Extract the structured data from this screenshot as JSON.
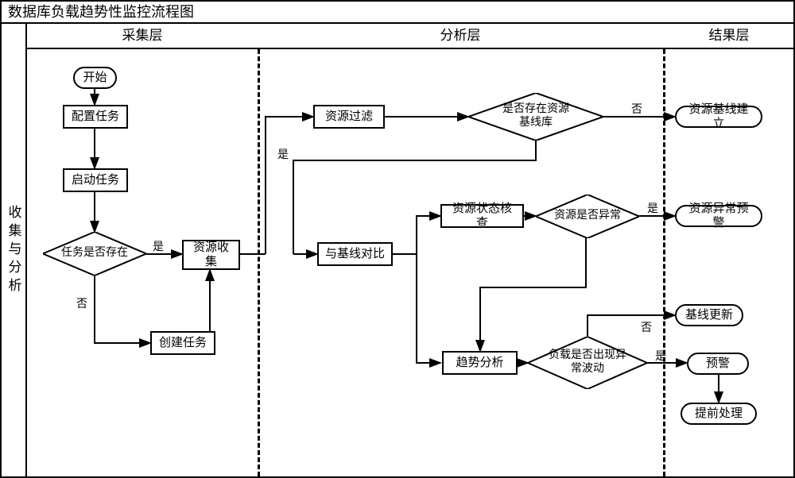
{
  "title": "数据库负载趋势性监控流程图",
  "headers": {
    "col1": "采集层",
    "col2": "分析层",
    "col3": "结果层"
  },
  "side_label": "收集与分析",
  "nodes": {
    "start": "开始",
    "config": "配置任务",
    "launch": "启动任务",
    "task_exist": "任务是否存在",
    "collect": "资源收集",
    "create": "创建任务",
    "filter": "资源过滤",
    "baseline_exist": "是否存在资源\n基线库",
    "baseline_build": "资源基线建立",
    "compare": "与基线对比",
    "check": "资源状态核查",
    "trend": "趋势分析",
    "res_abnormal": "资源是否异常",
    "abnormal_warn": "资源异常预警",
    "load_abnormal": "负载是否出现异\n常波动",
    "baseline_update": "基线更新",
    "warn": "预警",
    "preprocess": "提前处理"
  },
  "labels": {
    "yes": "是",
    "no": "否"
  }
}
